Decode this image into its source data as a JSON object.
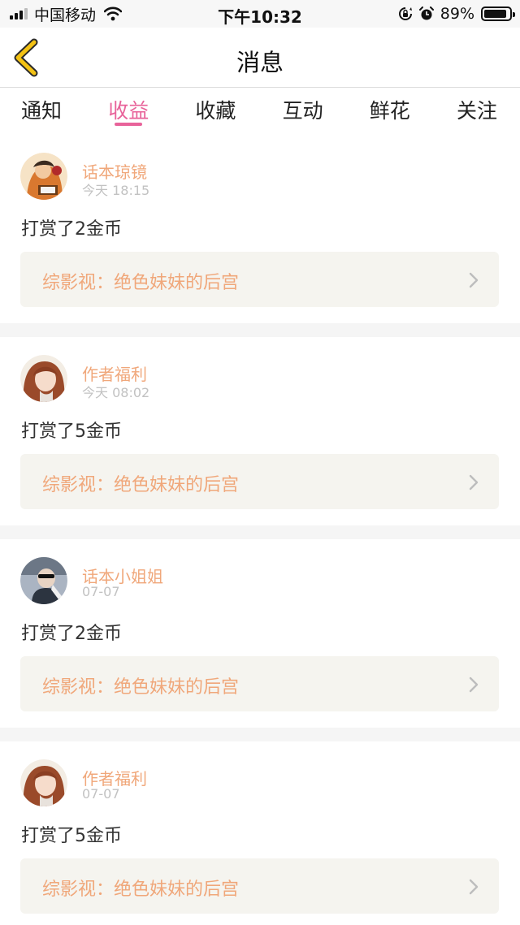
{
  "status_bar": {
    "carrier": "中国移动",
    "time": "下午10:32",
    "battery_pct": "89%",
    "battery_level": 0.89
  },
  "header": {
    "title": "消息",
    "back_icon": "chevron-left-icon"
  },
  "tabs": [
    {
      "label": "通知",
      "active": false
    },
    {
      "label": "收益",
      "active": true
    },
    {
      "label": "收藏",
      "active": false
    },
    {
      "label": "互动",
      "active": false
    },
    {
      "label": "鲜花",
      "active": false
    },
    {
      "label": "关注",
      "active": false
    }
  ],
  "messages": [
    {
      "sender": "话本琼镜",
      "time": "今天 18:15",
      "content": "打赏了2金币",
      "book": "综影视：绝色妹妹的后宫"
    },
    {
      "sender": "作者福利",
      "time": "今天 08:02",
      "content": "打赏了5金币",
      "book": "综影视：绝色妹妹的后宫"
    },
    {
      "sender": "话本小姐姐",
      "time": "07-07",
      "content": "打赏了2金币",
      "book": "综影视：绝色妹妹的后宫"
    },
    {
      "sender": "作者福利",
      "time": "07-07",
      "content": "打赏了5金币",
      "book": "综影视：绝色妹妹的后宫"
    }
  ],
  "colors": {
    "accent": "#e8639a",
    "sender": "#f0a77a",
    "back_arrow": "#f3c214"
  }
}
